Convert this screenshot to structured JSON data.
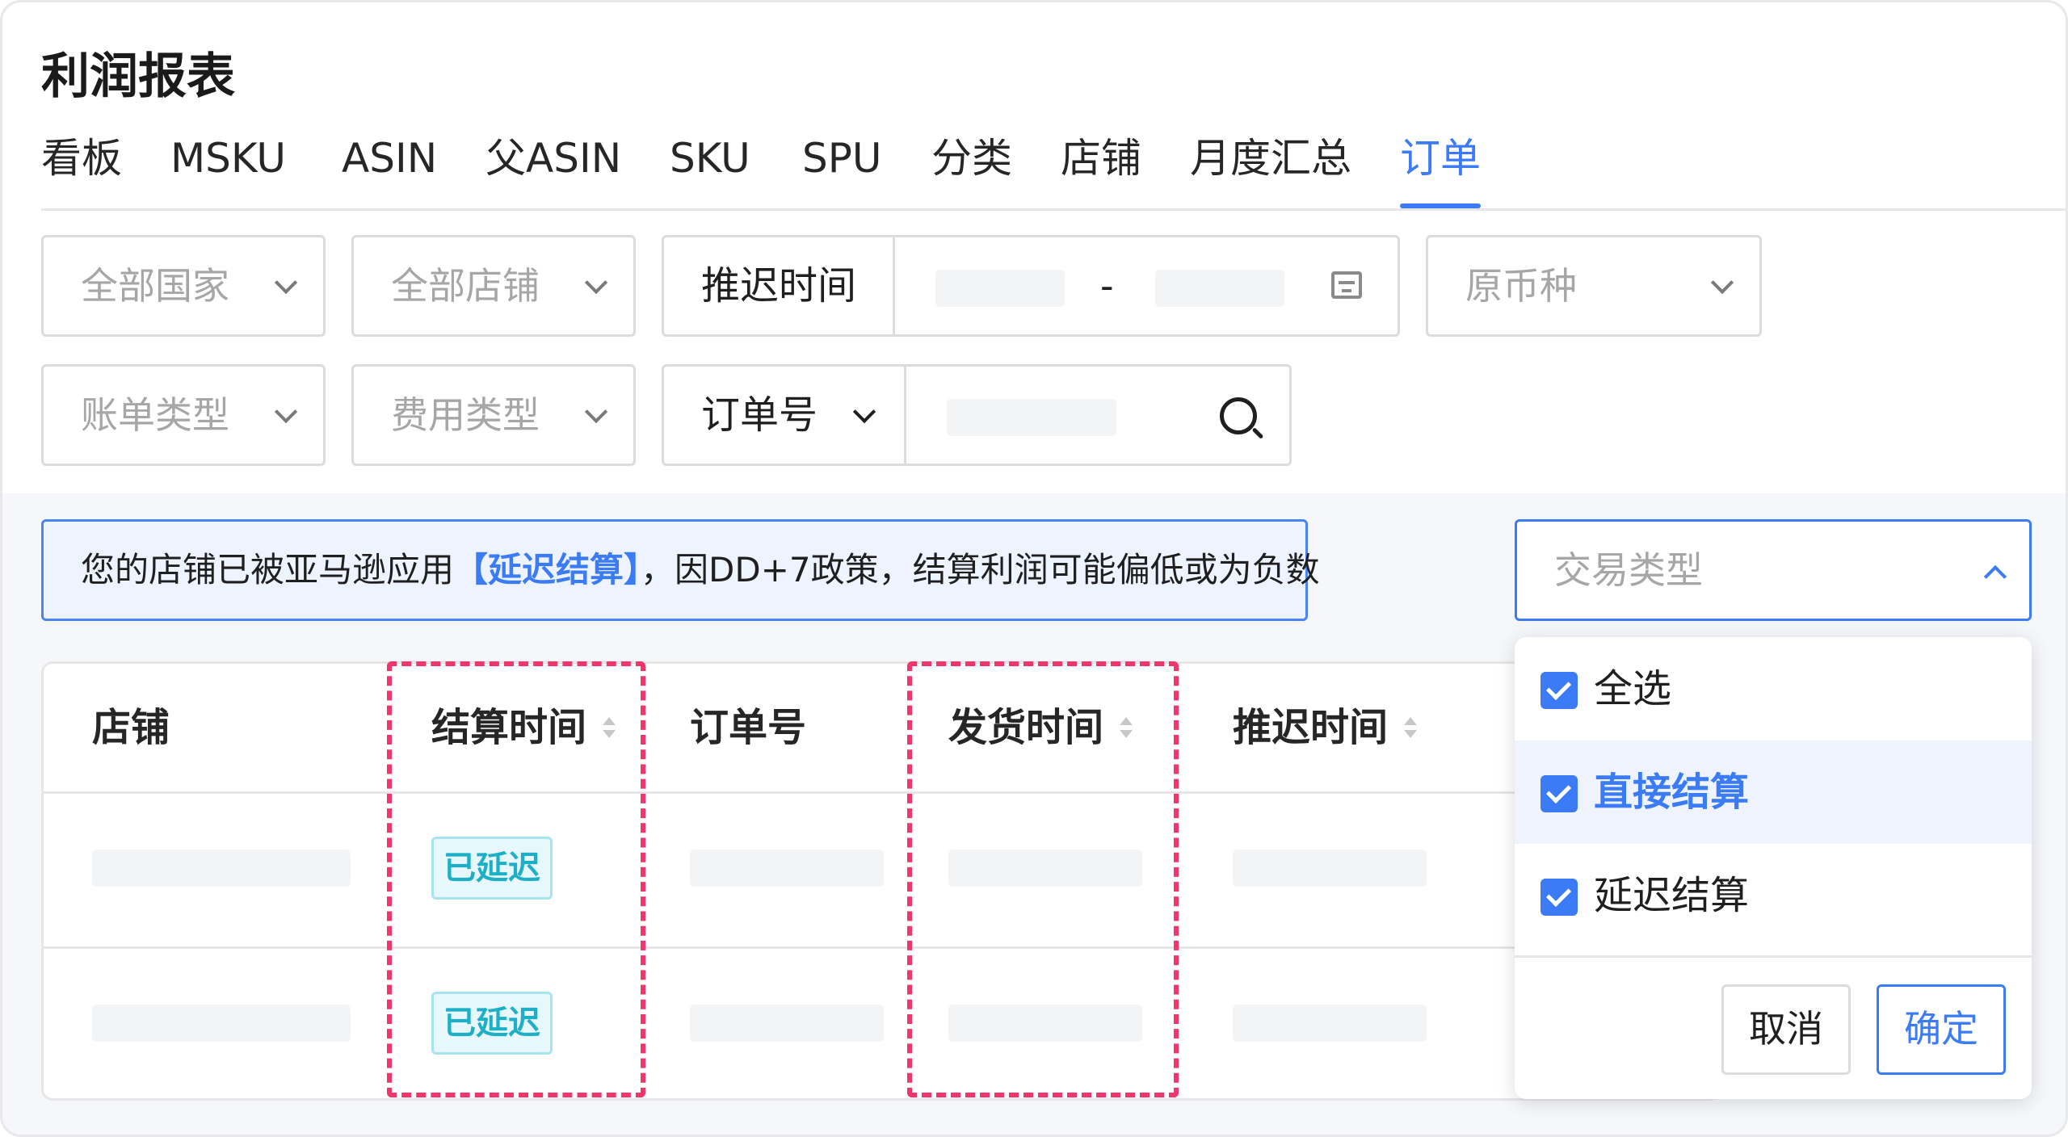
{
  "header": {
    "title": "利润报表",
    "tabs": [
      "看板",
      "MSKU",
      "ASIN",
      "父ASIN",
      "SKU",
      "SPU",
      "分类",
      "店铺",
      "月度汇总",
      "订单"
    ],
    "active_tab": "订单"
  },
  "filters": {
    "country": "全部国家",
    "shop": "全部店铺",
    "delay_time_label": "推迟时间",
    "range_separator": "-",
    "currency": "原币种",
    "bill_type": "账单类型",
    "fee_type": "费用类型",
    "order_no_label": "订单号"
  },
  "alert": {
    "prefix": "您的店铺已被亚马逊应用",
    "highlight": "【延迟结算】",
    "suffix": "，因DD+7政策，结算利润可能偏低或为负数"
  },
  "table": {
    "columns": [
      "店铺",
      "结算时间",
      "订单号",
      "发货时间",
      "推迟时间"
    ],
    "rows": [
      {
        "status": "已延迟"
      },
      {
        "status": "已延迟"
      }
    ]
  },
  "type_select": {
    "placeholder": "交易类型",
    "options": [
      {
        "label": "全选",
        "checked": true
      },
      {
        "label": "直接结算",
        "checked": true
      },
      {
        "label": "延迟结算",
        "checked": true
      }
    ],
    "cancel_label": "取消",
    "confirm_label": "确定"
  },
  "colors": {
    "accent": "#3b7bf5",
    "badge_text": "#1eaec6",
    "highlight_dash": "#f2356a"
  }
}
